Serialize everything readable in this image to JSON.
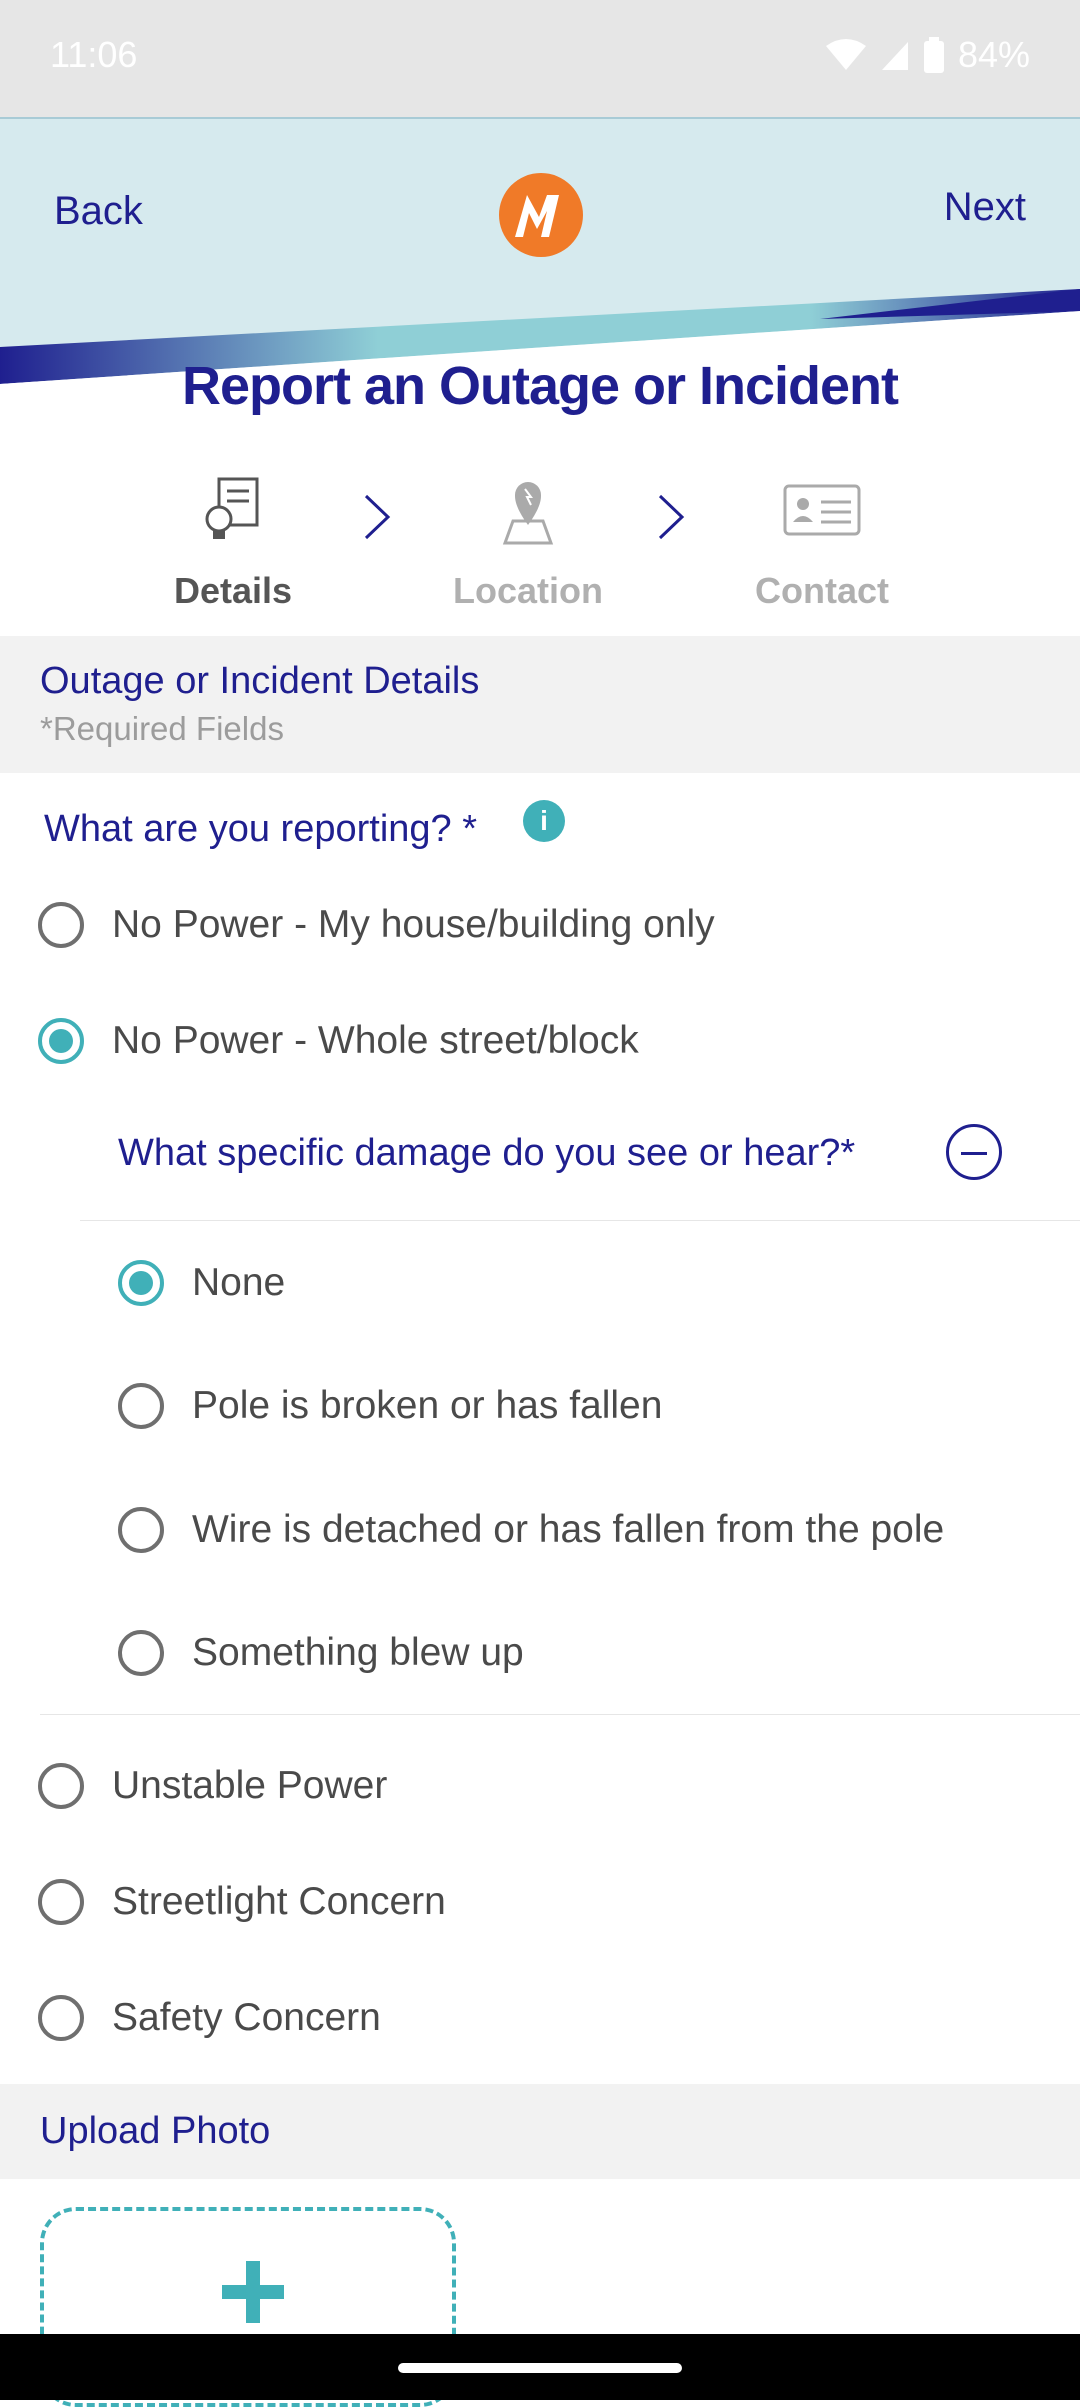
{
  "status_bar": {
    "time": "11:06",
    "battery": "84%"
  },
  "header": {
    "back_label": "Back",
    "next_label": "Next"
  },
  "page_title": "Report an Outage or Incident",
  "steps": [
    {
      "label": "Details",
      "icon": "details-icon",
      "active": true
    },
    {
      "label": "Location",
      "icon": "location-pin-icon",
      "active": false
    },
    {
      "label": "Contact",
      "icon": "contact-card-icon",
      "active": false
    }
  ],
  "details_section": {
    "title": "Outage or Incident Details",
    "subtitle": "*Required Fields"
  },
  "question": {
    "text": "What are you reporting? *",
    "info_icon": "i"
  },
  "report_options": [
    {
      "label": "No Power - My house/building only",
      "checked": false
    },
    {
      "label": "No Power - Whole street/block",
      "checked": true
    },
    {
      "label": "Unstable Power",
      "checked": false
    },
    {
      "label": "Streetlight Concern",
      "checked": false
    },
    {
      "label": "Safety Concern",
      "checked": false
    }
  ],
  "damage_question": {
    "text": "What specific damage do you see or hear?*"
  },
  "damage_options": [
    {
      "label": "None",
      "checked": true
    },
    {
      "label": "Pole is broken or has fallen",
      "checked": false
    },
    {
      "label": "Wire is detached or has fallen from the pole",
      "checked": false
    },
    {
      "label": "Something blew up",
      "checked": false
    }
  ],
  "upload_section": {
    "title": "Upload Photo"
  },
  "colors": {
    "brand_navy": "#1f1f8f",
    "accent_teal": "#40b0b8",
    "logo_orange": "#f07a28"
  }
}
